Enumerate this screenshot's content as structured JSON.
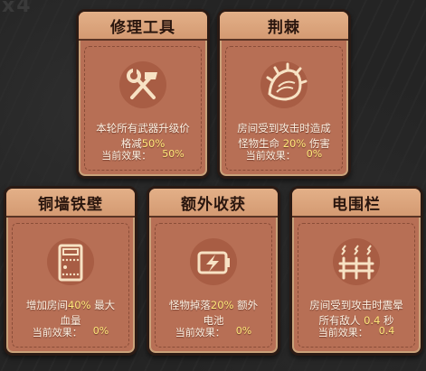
{
  "background": {
    "text": "x4"
  },
  "cards": [
    {
      "title": "修理工具",
      "icon": "wrench-hammer-icon",
      "desc_line1_pre": "本轮所有武器升级价",
      "desc_line2_pre": "格减",
      "desc_line2_hl": "50%",
      "desc_line2_post": "",
      "effect_label": "当前效果：",
      "effect_value": "50%"
    },
    {
      "title": "荆棘",
      "icon": "spiked-shell-icon",
      "desc_line1_pre": "房间受到攻击时造成",
      "desc_line2_pre": "怪物生命",
      "desc_line2_hl": "20%",
      "desc_line2_post": "伤害",
      "effect_label": "当前效果：",
      "effect_value": "0%"
    },
    {
      "title": "铜墙铁壁",
      "icon": "reinforced-door-icon",
      "desc_line1_pre": "增加房间",
      "desc_line1_hl": "40%",
      "desc_line1_post": "最大",
      "desc_line2_pre": "血量",
      "effect_label": "当前效果：",
      "effect_value": "0%"
    },
    {
      "title": "额外收获",
      "icon": "battery-bolt-icon",
      "desc_line1_pre": "怪物掉落",
      "desc_line1_hl": "20%",
      "desc_line1_post": "额外",
      "desc_line2_pre": "电池",
      "effect_label": "当前效果：",
      "effect_value": "0%"
    },
    {
      "title": "电围栏",
      "icon": "electric-fence-icon",
      "desc_line1_pre": "房间受到攻击时震晕",
      "desc_line2_pre": "所有敌人",
      "desc_line2_hl": "0.4",
      "desc_line2_post": "秒",
      "effect_label": "当前效果：",
      "effect_value": "0.4"
    }
  ],
  "colors": {
    "card_bg": "#b76f55",
    "header_bg": "#e3b088",
    "highlight": "#ffe87a",
    "icon": "#f7e2c4"
  }
}
